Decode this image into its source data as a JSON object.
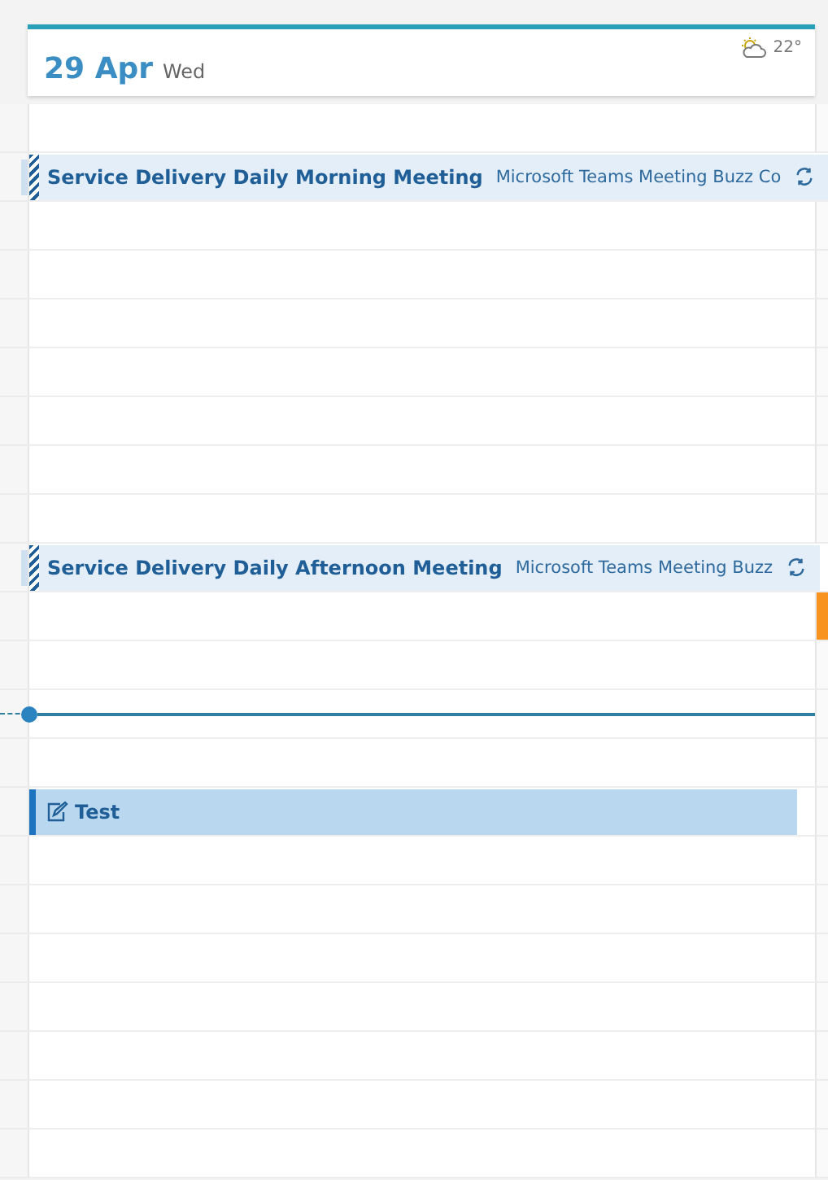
{
  "header": {
    "date": "29 Apr",
    "weekday": "Wed",
    "temperature": "22°"
  },
  "slots": [
    {
      "kind": "empty"
    },
    {
      "kind": "meeting",
      "title": "Service Delivery Daily Morning Meeting",
      "location": "Microsoft Teams Meeting Buzz Co"
    },
    {
      "kind": "empty"
    },
    {
      "kind": "empty"
    },
    {
      "kind": "empty"
    },
    {
      "kind": "empty"
    },
    {
      "kind": "empty"
    },
    {
      "kind": "empty"
    },
    {
      "kind": "empty"
    },
    {
      "kind": "meeting",
      "title": "Service Delivery Daily Afternoon Meeting",
      "location": "Microsoft Teams Meeting Buzz"
    },
    {
      "kind": "empty",
      "color": "#f7931e"
    },
    {
      "kind": "empty"
    },
    {
      "kind": "now"
    },
    {
      "kind": "empty"
    },
    {
      "kind": "task",
      "title": "Test"
    },
    {
      "kind": "empty"
    },
    {
      "kind": "empty"
    },
    {
      "kind": "empty"
    },
    {
      "kind": "empty"
    },
    {
      "kind": "empty"
    },
    {
      "kind": "empty"
    },
    {
      "kind": "empty"
    }
  ]
}
